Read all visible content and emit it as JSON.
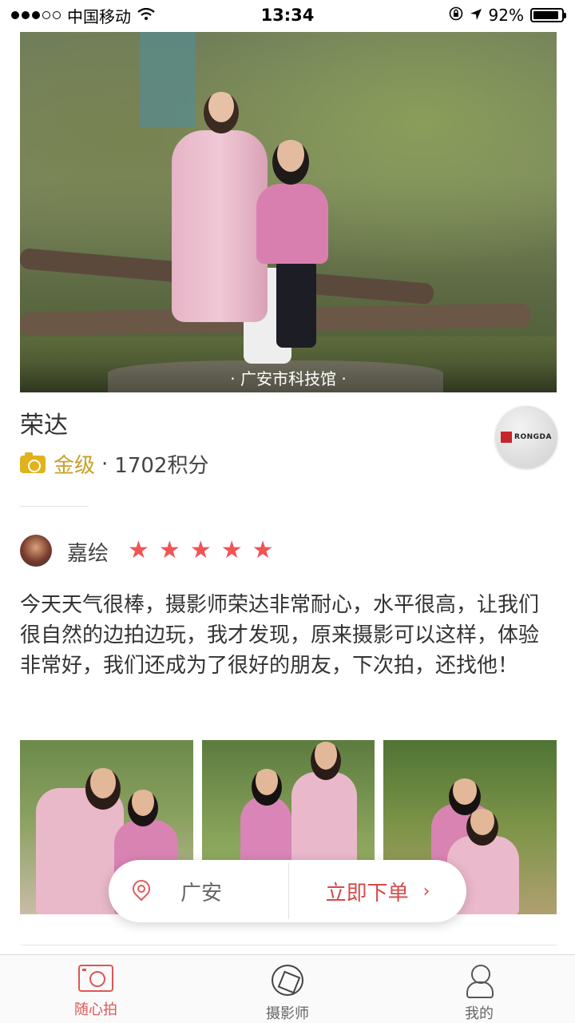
{
  "status_bar": {
    "carrier": "中国移动",
    "time": "13:34",
    "battery": "92%",
    "battery_level": 0.92,
    "icons": [
      "signal-dots-icon",
      "wifi-icon",
      "orientation-lock-icon",
      "location-arrow-icon",
      "battery-icon"
    ]
  },
  "hero": {
    "location_caption": "· 广安市科技馆 ·"
  },
  "photographer": {
    "name": "荣达",
    "level": "金级",
    "separator": "·",
    "points": "1702积分",
    "logo_text": "RONGDA",
    "level_icon": "camera-badge-icon"
  },
  "review": {
    "reviewer": "嘉绘",
    "rating": 5,
    "stars": [
      "★",
      "★",
      "★",
      "★",
      "★"
    ],
    "text": "今天天气很棒，摄影师荣达非常耐心，水平很高，让我们很自然的边拍边玩，我才发现，原来摄影可以这样，体验非常好，我们还成为了很好的朋友，下次拍，还找他！",
    "colors": {
      "star": "#f05454"
    }
  },
  "action_bar": {
    "location": "广安",
    "order_label": "立即下单",
    "order_arrow": "›",
    "colors": {
      "accent": "#d54a4a"
    }
  },
  "tab_bar": {
    "tabs": [
      {
        "label": "随心拍",
        "icon": "camera-icon",
        "active": true
      },
      {
        "label": "摄影师",
        "icon": "aperture-icon",
        "active": false
      },
      {
        "label": "我的",
        "icon": "user-icon",
        "active": false
      }
    ],
    "colors": {
      "active": "#e05656"
    }
  }
}
